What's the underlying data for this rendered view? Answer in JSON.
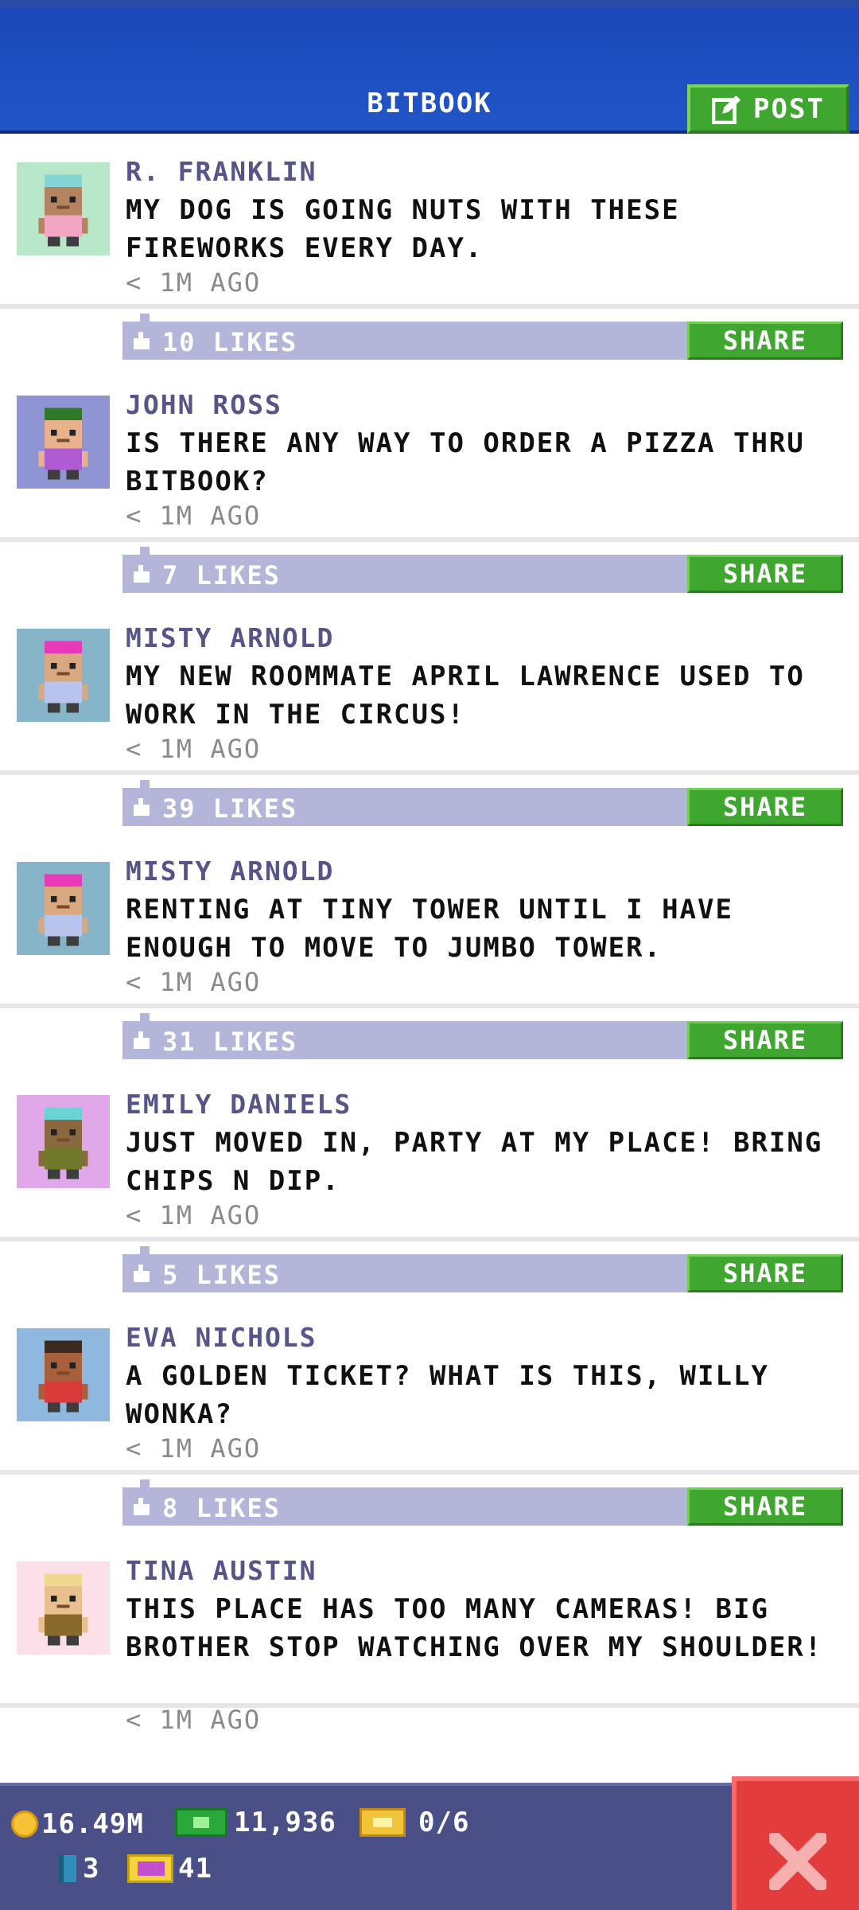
{
  "header": {
    "title": "BITBOOK",
    "post_label": "POST"
  },
  "posts": [
    {
      "author": "R. FRANKLIN",
      "message": "MY DOG IS GOING NUTS WITH THESE FIREWORKS EVERY DAY.",
      "time": "< 1M AGO",
      "likes": "10 LIKES",
      "share": "SHARE",
      "avatar": {
        "bg": "#b7e6c8",
        "hair": "#86d4d4",
        "skin": "#b3845f",
        "shirt": "#f2a6c3",
        "pants": "#3d3d3d"
      }
    },
    {
      "author": "JOHN ROSS",
      "message": "IS THERE ANY WAY TO ORDER A PIZZA THRU BITBOOK?",
      "time": "< 1M AGO",
      "likes": "7 LIKES",
      "share": "SHARE",
      "avatar": {
        "bg": "#8f95d4",
        "hair": "#2f7a2a",
        "skin": "#e8b38c",
        "shirt": "#b05ad4",
        "pants": "#3d3d3d"
      }
    },
    {
      "author": "MISTY ARNOLD",
      "message": "MY NEW ROOMMATE APRIL LAWRENCE USED TO WORK IN THE CIRCUS!",
      "time": "< 1M AGO",
      "likes": "39 LIKES",
      "share": "SHARE",
      "avatar": {
        "bg": "#86b4c8",
        "hair": "#e83ab8",
        "skin": "#d8a880",
        "shirt": "#b8c4ee",
        "pants": "#3d3d3d"
      }
    },
    {
      "author": "MISTY ARNOLD",
      "message": "RENTING AT TINY TOWER UNTIL I HAVE ENOUGH TO MOVE TO JUMBO TOWER.",
      "time": "< 1M AGO",
      "likes": "31 LIKES",
      "share": "SHARE",
      "avatar": {
        "bg": "#86b4c8",
        "hair": "#e83ab8",
        "skin": "#d8a880",
        "shirt": "#b8c4ee",
        "pants": "#3d3d3d"
      }
    },
    {
      "author": "EMILY DANIELS",
      "message": "JUST MOVED IN, PARTY AT MY PLACE! BRING CHIPS N DIP.",
      "time": "< 1M AGO",
      "likes": "5 LIKES",
      "share": "SHARE",
      "avatar": {
        "bg": "#e0a8e8",
        "hair": "#6ad4d4",
        "skin": "#8a6840",
        "shirt": "#6f7a2a",
        "pants": "#3d3d3d"
      }
    },
    {
      "author": "EVA NICHOLS",
      "message": "A GOLDEN TICKET? WHAT IS THIS, WILLY WONKA?",
      "time": "< 1M AGO",
      "likes": "8 LIKES",
      "share": "SHARE",
      "avatar": {
        "bg": "#8fb8e0",
        "hair": "#3a2a20",
        "skin": "#a8603a",
        "shirt": "#d83a3a",
        "pants": "#3d3d3d"
      }
    },
    {
      "author": "TINA AUSTIN",
      "message": "THIS PLACE HAS TOO MANY CAMERAS! BIG BROTHER STOP WATCHING OVER MY SHOULDER!",
      "time": "< 1M AGO",
      "likes": "",
      "share": "",
      "avatar": {
        "bg": "#fbe0ea",
        "hair": "#f0d890",
        "skin": "#e8c090",
        "shirt": "#8a6a2a",
        "pants": "#3d3d3d"
      }
    }
  ],
  "footer": {
    "coins": "16.49M",
    "cash": "11,936",
    "tickets": "0/6",
    "elevators": "3",
    "bux": "41"
  }
}
